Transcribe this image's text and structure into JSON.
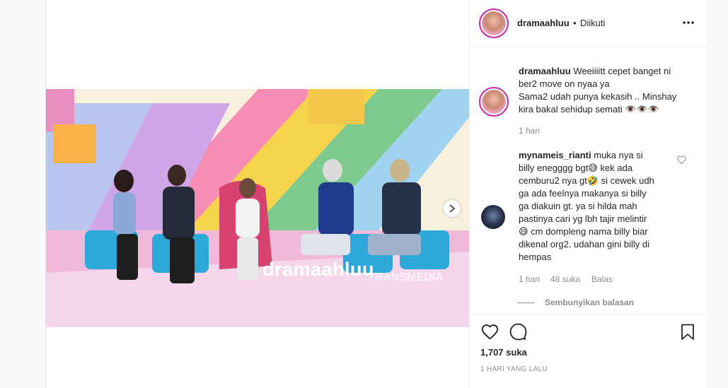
{
  "post": {
    "username": "dramaahluu",
    "separator": "•",
    "follow_status": "Diikuti",
    "more_icon": "more-horizontal-icon"
  },
  "video": {
    "watermark": "dramaahluu",
    "channel_watermark": "TRANSMEDIA",
    "next_icon": "chevron-right-icon"
  },
  "caption": {
    "username": "dramaahluu",
    "lines": [
      "Weeiiiitt cepet banget ni",
      "ber2 move on nyaa ya",
      "Sama2 udah punya kekasih .. Minshay",
      "kira bakal sehidup semati 👁️👁️👁️"
    ],
    "time": "1 hari"
  },
  "comment": {
    "username": "mynameis_rianti",
    "lines": [
      "muka nya si",
      "billy enegggg bgt😅 kek ada",
      "cemburu2 nya gt🤣 si cewek udh",
      "ga ada feelnya makanya si billy",
      "ga diakuin gt. ya si hilda mah",
      "pastinya cari yg lbh tajir melintir",
      "😅 cm dompleng nama billy biar",
      "dikenal org2. udahan gini billy di",
      "hempas"
    ],
    "time": "1 hari",
    "likes": "48 suka",
    "reply_label": "Balas",
    "hide_replies": "Sembunyikan balasan"
  },
  "footer": {
    "likes": "1,707 suka",
    "date": "1 HARI YANG LALU"
  },
  "colors": {
    "text": "#262626",
    "muted": "#8e8e8e",
    "ring": "#c32aa3"
  }
}
